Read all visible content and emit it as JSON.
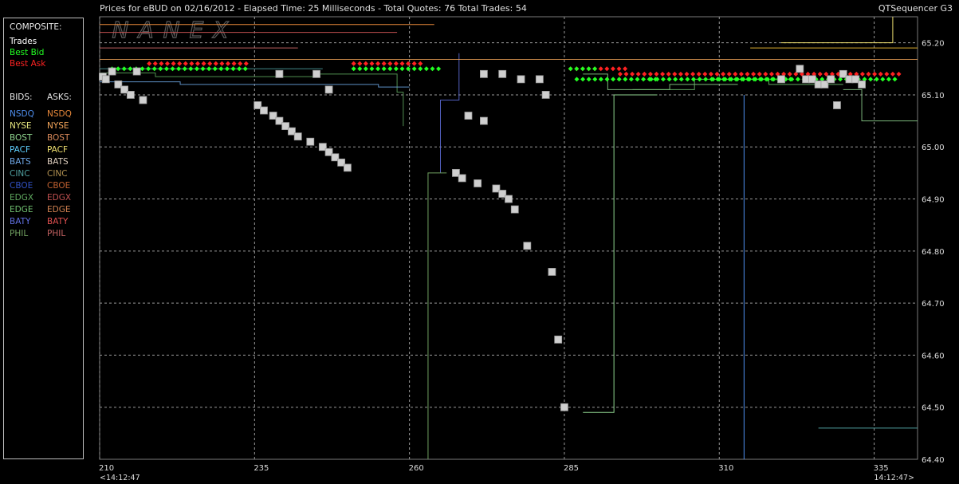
{
  "header": {
    "title": "Prices for  eBUD  on  02/16/2012  -  Elapsed Time: 25 Milliseconds  -  Total Quotes: 76  Total Trades: 54",
    "app_name": "QTSequencer G3",
    "watermark": "NANEX"
  },
  "legend": {
    "composite_label": "COMPOSITE:",
    "composite_items": [
      {
        "label": "Trades",
        "color": "#ffffff"
      },
      {
        "label": "Best Bid",
        "color": "#22ff22"
      },
      {
        "label": "Best Ask",
        "color": "#ff2222"
      }
    ],
    "bids_label": "BIDS:",
    "asks_label": "ASKS:",
    "exchanges": [
      {
        "label": "NSDQ",
        "bid_color": "#4f8ff0",
        "ask_color": "#e8883a"
      },
      {
        "label": "NYSE",
        "bid_color": "#e8e880",
        "ask_color": "#f5a65a"
      },
      {
        "label": "BOST",
        "bid_color": "#8fd58f",
        "ask_color": "#d9895a"
      },
      {
        "label": "PACF",
        "bid_color": "#5fd0ff",
        "ask_color": "#f0e070"
      },
      {
        "label": "BATS",
        "bid_color": "#6fa8e8",
        "ask_color": "#e0d0c0"
      },
      {
        "label": "CINC",
        "bid_color": "#4fa0a0",
        "ask_color": "#b09050"
      },
      {
        "label": "CBOE",
        "bid_color": "#3050c0",
        "ask_color": "#c06030"
      },
      {
        "label": "EDGX",
        "bid_color": "#5fa85f",
        "ask_color": "#c05050"
      },
      {
        "label": "EDGE",
        "bid_color": "#70c070",
        "ask_color": "#d08050"
      },
      {
        "label": "BATY",
        "bid_color": "#6070e0",
        "ask_color": "#e05050"
      },
      {
        "label": "PHIL",
        "bid_color": "#70a060",
        "ask_color": "#c06060"
      }
    ]
  },
  "footer": {
    "start_time": "<14:12:47",
    "end_time": "14:12:47>"
  },
  "chart_data": {
    "type": "scatter",
    "xlim": [
      210,
      342
    ],
    "ylim": [
      64.4,
      65.25
    ],
    "x_ticks": [
      210,
      235,
      260,
      285,
      310,
      335
    ],
    "y_ticks": [
      65.2,
      65.1,
      65.0,
      64.9,
      64.8,
      64.7,
      64.6,
      64.5,
      64.4
    ],
    "grid": true,
    "trades": [
      [
        210.5,
        65.135
      ],
      [
        211,
        65.13
      ],
      [
        212,
        65.145
      ],
      [
        213,
        65.12
      ],
      [
        214,
        65.11
      ],
      [
        215,
        65.1
      ],
      [
        216,
        65.145
      ],
      [
        217,
        65.09
      ],
      [
        235.5,
        65.08
      ],
      [
        236.5,
        65.07
      ],
      [
        238,
        65.06
      ],
      [
        239,
        65.05
      ],
      [
        240,
        65.04
      ],
      [
        241,
        65.03
      ],
      [
        242,
        65.02
      ],
      [
        244,
        65.01
      ],
      [
        246,
        65.0
      ],
      [
        247,
        64.99
      ],
      [
        248,
        64.98
      ],
      [
        249,
        64.97
      ],
      [
        250,
        64.96
      ],
      [
        239,
        65.14
      ],
      [
        245,
        65.14
      ],
      [
        247,
        65.11
      ],
      [
        267.5,
        64.95
      ],
      [
        268.5,
        64.94
      ],
      [
        269.5,
        65.06
      ],
      [
        271,
        64.93
      ],
      [
        272,
        65.05
      ],
      [
        274,
        64.92
      ],
      [
        275,
        64.91
      ],
      [
        276,
        64.9
      ],
      [
        277,
        64.88
      ],
      [
        279,
        64.81
      ],
      [
        272,
        65.14
      ],
      [
        275,
        65.14
      ],
      [
        278,
        65.13
      ],
      [
        281,
        65.13
      ],
      [
        282,
        65.1
      ],
      [
        283,
        64.76
      ],
      [
        284,
        64.63
      ],
      [
        285,
        64.5
      ],
      [
        323,
        65.15
      ],
      [
        324,
        65.13
      ],
      [
        325,
        65.13
      ],
      [
        326,
        65.12
      ],
      [
        327,
        65.12
      ],
      [
        328,
        65.13
      ],
      [
        329,
        65.08
      ],
      [
        330,
        65.14
      ],
      [
        331,
        65.13
      ],
      [
        332,
        65.13
      ],
      [
        333,
        65.12
      ],
      [
        320,
        65.13
      ]
    ],
    "best_ask": {
      "segments": [
        [
          218,
          234,
          65.16
        ],
        [
          251,
          262,
          65.16
        ],
        [
          286,
          295,
          65.15
        ],
        [
          294,
          339,
          65.14
        ]
      ]
    },
    "best_bid": {
      "segments": [
        [
          212,
          234,
          65.15
        ],
        [
          251,
          265,
          65.15
        ],
        [
          286,
          290,
          65.15
        ],
        [
          287,
          300,
          65.13
        ],
        [
          299,
          322,
          65.13
        ],
        [
          309,
          339,
          65.13
        ]
      ]
    }
  }
}
